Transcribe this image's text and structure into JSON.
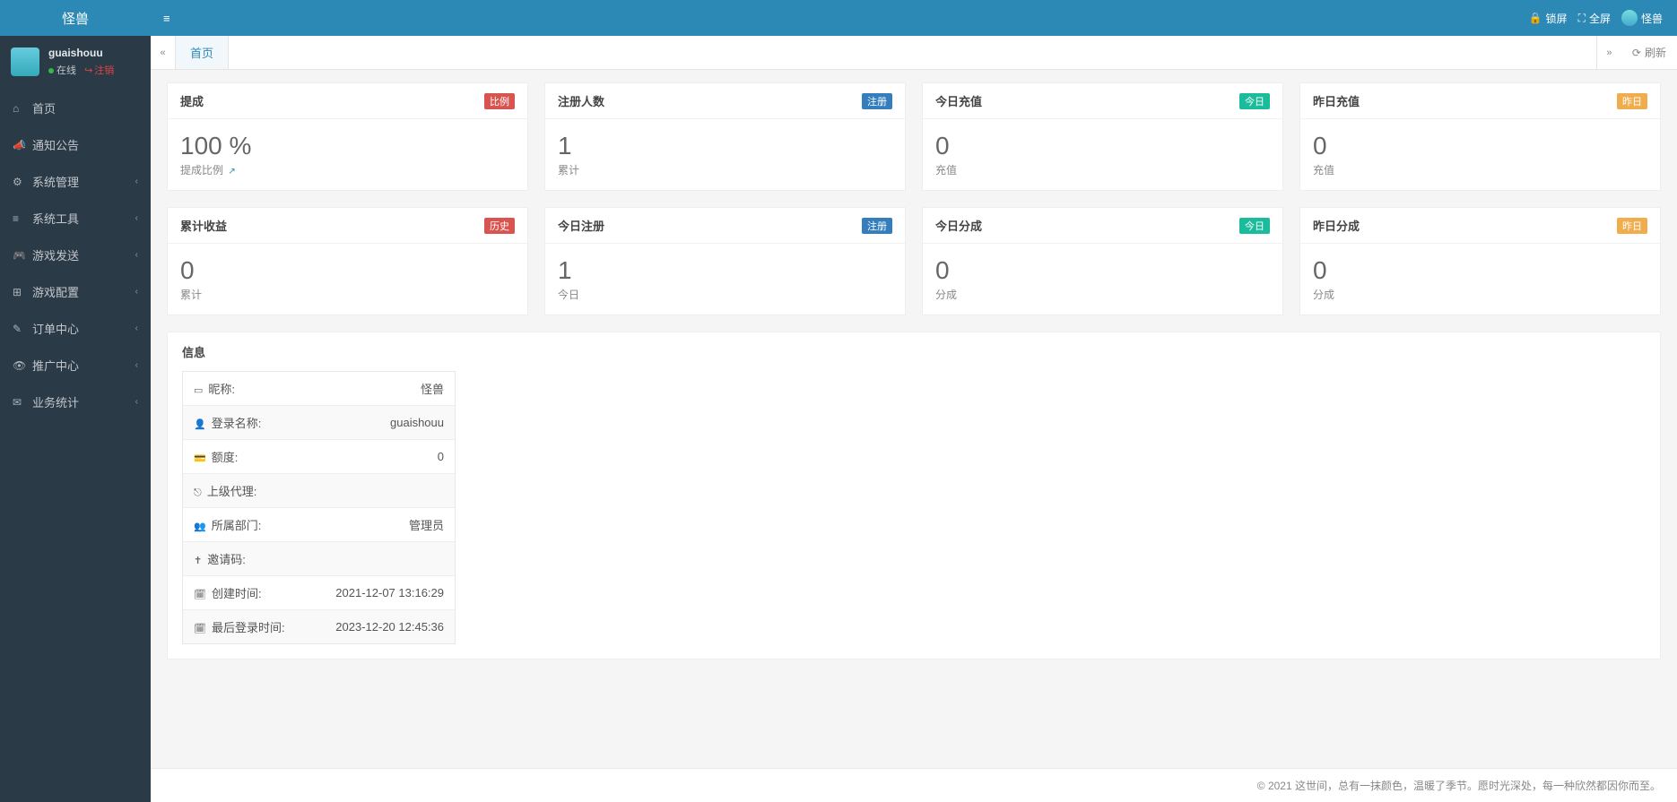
{
  "app": {
    "title": "怪兽"
  },
  "topbar": {
    "lock": "锁屏",
    "fullscreen": "全屏",
    "user_label": "怪兽"
  },
  "user": {
    "name": "guaishouu",
    "online": "在线",
    "logout": "注销"
  },
  "nav": [
    {
      "icon": "⌂",
      "label": "首页",
      "expandable": false
    },
    {
      "icon": "📣",
      "label": "通知公告",
      "expandable": false
    },
    {
      "icon": "⚙",
      "label": "系统管理",
      "expandable": true
    },
    {
      "icon": "≡",
      "label": "系统工具",
      "expandable": true
    },
    {
      "icon": "🎮",
      "label": "游戏发送",
      "expandable": true
    },
    {
      "icon": "⊞",
      "label": "游戏配置",
      "expandable": true
    },
    {
      "icon": "✎",
      "label": "订单中心",
      "expandable": true
    },
    {
      "icon": "👁",
      "label": "推广中心",
      "expandable": true
    },
    {
      "icon": "✉",
      "label": "业务统计",
      "expandable": true
    }
  ],
  "tabs": {
    "active": "首页",
    "refresh": "刷新"
  },
  "cards": {
    "r1": [
      {
        "title": "提成",
        "badge": "比例",
        "badge_cls": "b-red",
        "value": "100 %",
        "sub": "提成比例",
        "link": true
      },
      {
        "title": "注册人数",
        "badge": "注册",
        "badge_cls": "b-blue",
        "value": "1",
        "sub": "累计"
      },
      {
        "title": "今日充值",
        "badge": "今日",
        "badge_cls": "b-teal",
        "value": "0",
        "sub": "充值"
      },
      {
        "title": "昨日充值",
        "badge": "昨日",
        "badge_cls": "b-orange",
        "value": "0",
        "sub": "充值"
      }
    ],
    "r2": [
      {
        "title": "累计收益",
        "badge": "历史",
        "badge_cls": "b-red",
        "value": "0",
        "sub": "累计"
      },
      {
        "title": "今日注册",
        "badge": "注册",
        "badge_cls": "b-blue",
        "value": "1",
        "sub": "今日"
      },
      {
        "title": "今日分成",
        "badge": "今日",
        "badge_cls": "b-teal",
        "value": "0",
        "sub": "分成"
      },
      {
        "title": "昨日分成",
        "badge": "昨日",
        "badge_cls": "b-orange",
        "value": "0",
        "sub": "分成"
      }
    ]
  },
  "info": {
    "title": "信息",
    "rows": [
      {
        "icon": "▭",
        "label": "昵称:",
        "value": "怪兽"
      },
      {
        "icon": "👤",
        "label": "登录名称:",
        "value": "guaishouu"
      },
      {
        "icon": "💳",
        "label": "额度:",
        "value": "0"
      },
      {
        "icon": "⎋",
        "label": "上级代理:",
        "value": ""
      },
      {
        "icon": "👥",
        "label": "所属部门:",
        "value": "管理员"
      },
      {
        "icon": "✝",
        "label": "邀请码:",
        "value": ""
      },
      {
        "icon": "🗓",
        "label": "创建时间:",
        "value": "2021-12-07 13:16:29"
      },
      {
        "icon": "🗓",
        "label": "最后登录时间:",
        "value": "2023-12-20 12:45:36"
      }
    ]
  },
  "footer": "© 2021 这世间，总有一抹颜色，温暖了季节。愿时光深处，每一种欣然都因你而至。"
}
